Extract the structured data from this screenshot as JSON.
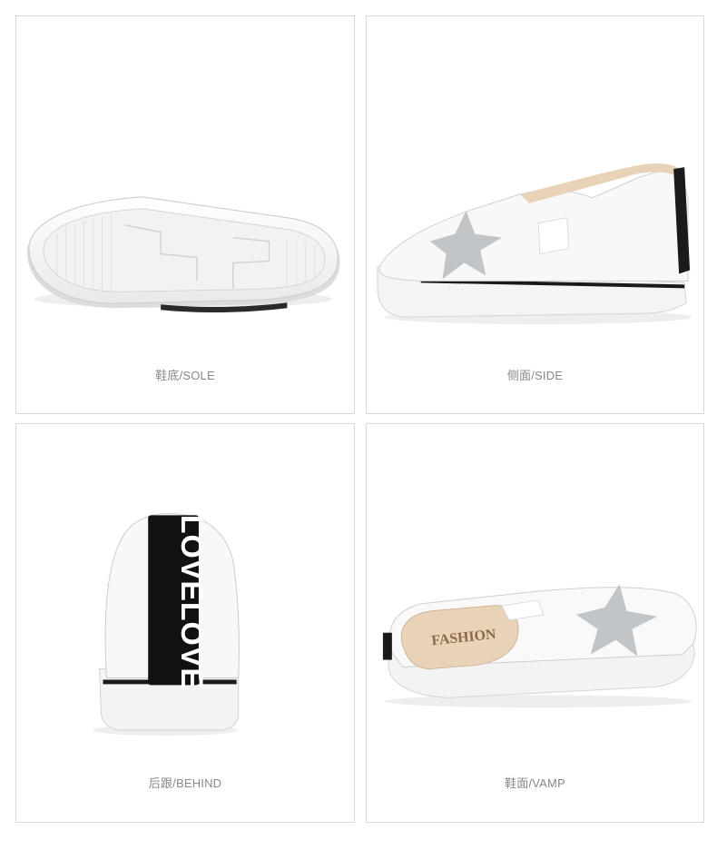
{
  "panels": [
    {
      "caption": "鞋底/SOLE",
      "photo": "shoe-sole-photo"
    },
    {
      "caption": "侧面/SIDE",
      "photo": "shoe-side-photo"
    },
    {
      "caption": "后跟/BEHIND",
      "photo": "shoe-heel-photo",
      "heel_tab_text": "LOVELOVE"
    },
    {
      "caption": "鞋面/VAMP",
      "photo": "shoe-vamp-photo",
      "insole_text": "FASHION"
    }
  ],
  "colors": {
    "panel_border": "#d9d9d9",
    "caption": "#888888",
    "shoe_white": "#f7f7f7",
    "trim_black": "#1a1a1a",
    "star_silver": "#b9bcbf",
    "lining_tan": "#e9d3b8"
  }
}
